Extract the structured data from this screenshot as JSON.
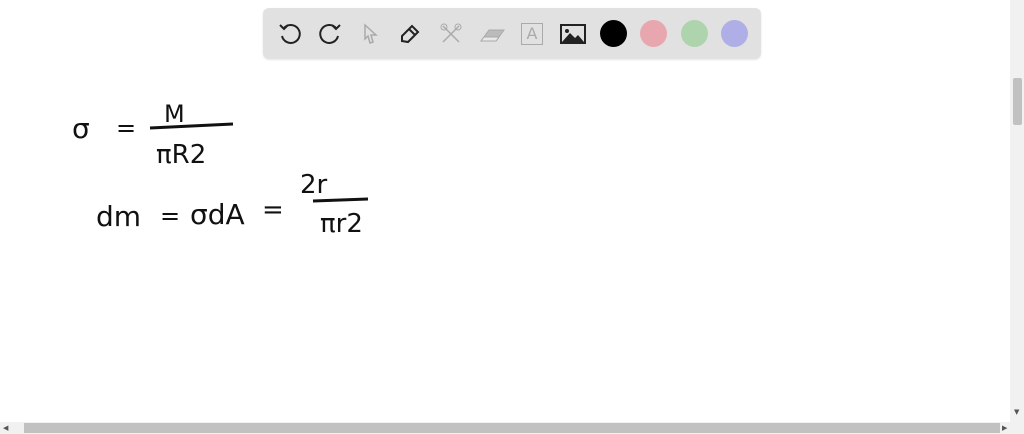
{
  "toolbar": {
    "tools": [
      {
        "name": "undo-icon",
        "enabled": true
      },
      {
        "name": "redo-icon",
        "enabled": true
      },
      {
        "name": "select-pointer-icon",
        "enabled": false
      },
      {
        "name": "pen-icon",
        "enabled": true
      },
      {
        "name": "tools-icon",
        "enabled": false
      },
      {
        "name": "eraser-icon",
        "enabled": false
      },
      {
        "name": "text-icon",
        "enabled": false,
        "label": "A"
      },
      {
        "name": "image-icon",
        "enabled": true
      }
    ],
    "colors": [
      "#000000",
      "#e8a7ae",
      "#add4ad",
      "#b0aee6"
    ]
  },
  "canvas": {
    "line1": {
      "lhs": "σ",
      "eq": "=",
      "num": "M",
      "den": "πR2"
    },
    "line2": {
      "lhs": "dm",
      "eq1": "=",
      "mid": "σdA",
      "eq2": "=",
      "num": "2r",
      "den": "πr2"
    }
  }
}
